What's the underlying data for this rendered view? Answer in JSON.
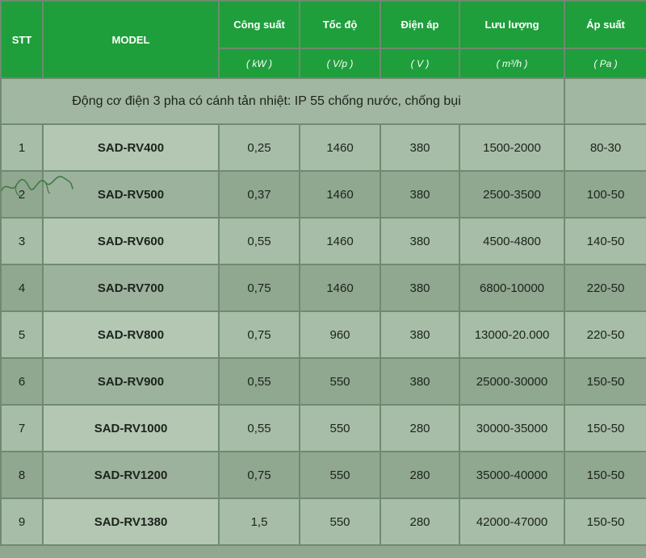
{
  "header": {
    "stt": "STT",
    "model": "MODEL",
    "cong_suat": "Công suất",
    "toc_do": "Tốc độ",
    "dien_ap": "Điện áp",
    "luu_luong": "Lưu lượng",
    "ap_suat": "Áp suất"
  },
  "units": {
    "cong_suat": "( kW )",
    "toc_do": "( V/p )",
    "dien_ap": "( V )",
    "luu_luong": "( m³/h )",
    "ap_suat": "( Pa )"
  },
  "description": "Động cơ điện 3 pha có cánh tản nhiệt: IP 55 chống nước, chống bụi",
  "rows": [
    {
      "stt": "1",
      "model": "SAD-RV400",
      "cong_suat": "0,25",
      "toc_do": "1460",
      "dien_ap": "380",
      "luu_luong": "1500-2000",
      "ap_suat": "80-30"
    },
    {
      "stt": "2",
      "model": "SAD-RV500",
      "cong_suat": "0,37",
      "toc_do": "1460",
      "dien_ap": "380",
      "luu_luong": "2500-3500",
      "ap_suat": "100-50"
    },
    {
      "stt": "3",
      "model": "SAD-RV600",
      "cong_suat": "0,55",
      "toc_do": "1460",
      "dien_ap": "380",
      "luu_luong": "4500-4800",
      "ap_suat": "140-50"
    },
    {
      "stt": "4",
      "model": "SAD-RV700",
      "cong_suat": "0,75",
      "toc_do": "1460",
      "dien_ap": "380",
      "luu_luong": "6800-10000",
      "ap_suat": "220-50"
    },
    {
      "stt": "5",
      "model": "SAD-RV800",
      "cong_suat": "0,75",
      "toc_do": "960",
      "dien_ap": "380",
      "luu_luong": "13000-20.000",
      "ap_suat": "220-50"
    },
    {
      "stt": "6",
      "model": "SAD-RV900",
      "cong_suat": "0,55",
      "toc_do": "550",
      "dien_ap": "380",
      "luu_luong": "25000-30000",
      "ap_suat": "150-50"
    },
    {
      "stt": "7",
      "model": "SAD-RV1000",
      "cong_suat": "0,55",
      "toc_do": "550",
      "dien_ap": "280",
      "luu_luong": "30000-35000",
      "ap_suat": "150-50"
    },
    {
      "stt": "8",
      "model": "SAD-RV1200",
      "cong_suat": "0,75",
      "toc_do": "550",
      "dien_ap": "280",
      "luu_luong": "35000-40000",
      "ap_suat": "150-50"
    },
    {
      "stt": "9",
      "model": "SAD-RV1380",
      "cong_suat": "1,5",
      "toc_do": "550",
      "dien_ap": "280",
      "luu_luong": "42000-47000",
      "ap_suat": "150-50"
    }
  ],
  "colors": {
    "header_green": "#1f9e3c",
    "row_light": "#a7bda7",
    "row_dark": "#90a790",
    "grid": "#6f8a70"
  }
}
